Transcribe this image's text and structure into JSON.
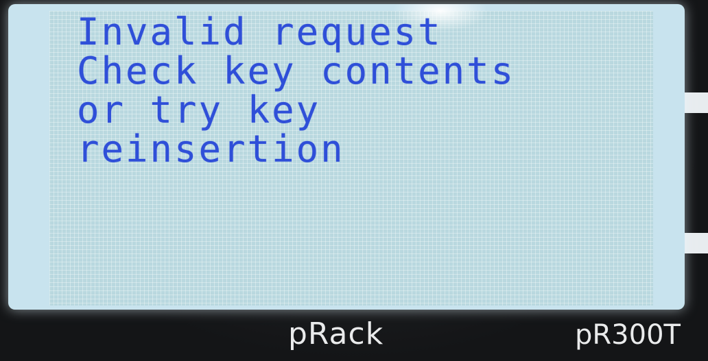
{
  "display": {
    "lines": [
      "Invalid request",
      "Check key contents",
      "or try key",
      "reinsertion"
    ]
  },
  "device": {
    "brand": "pRack",
    "model": "pR300T"
  },
  "colors": {
    "lcd_background": "#c8e3ee",
    "lcd_text": "#2f4fd8",
    "bezel": "#1a1c1e",
    "label": "#e9eaeb"
  }
}
